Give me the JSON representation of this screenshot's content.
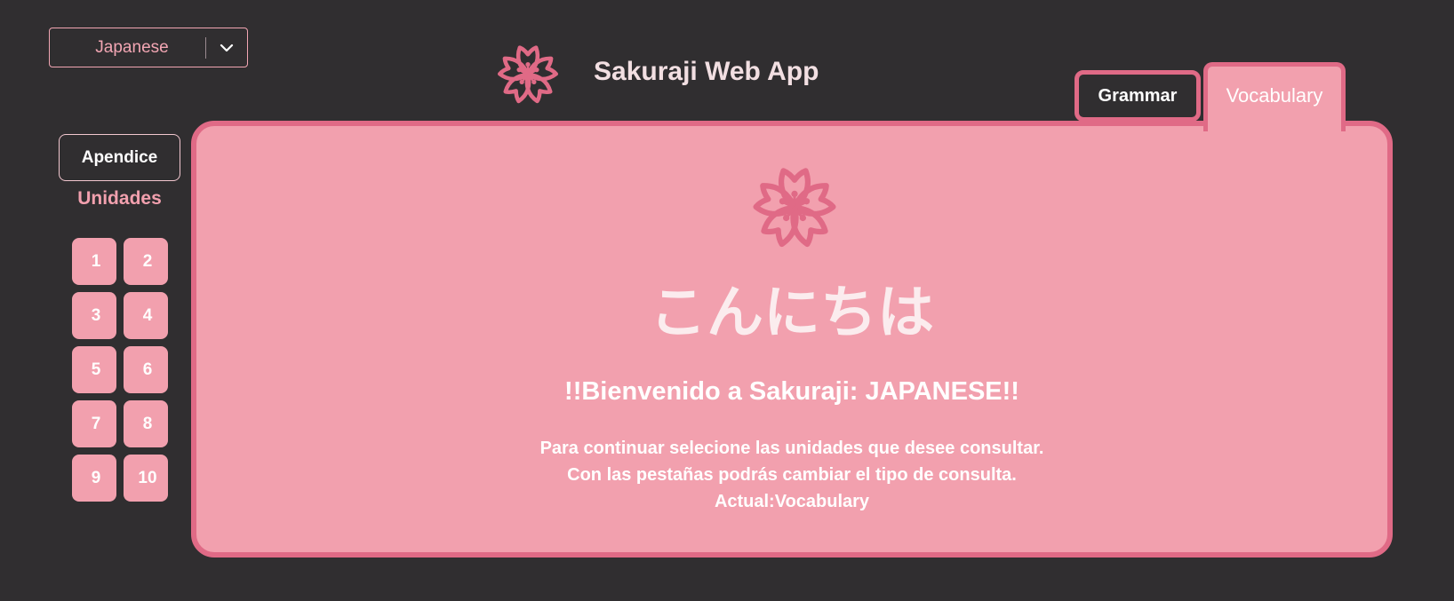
{
  "language_select": {
    "value": "Japanese"
  },
  "header": {
    "title": "Sakuraji Web App"
  },
  "tabs": [
    {
      "label": "Grammar",
      "active": false
    },
    {
      "label": "Vocabulary",
      "active": true
    }
  ],
  "sidebar": {
    "apendice_label": "Apendice",
    "unidades_title": "Unidades",
    "units": [
      "1",
      "2",
      "3",
      "4",
      "5",
      "6",
      "7",
      "8",
      "9",
      "10"
    ]
  },
  "main": {
    "greeting": "こんにちは",
    "welcome": "!!Bienvenido a Sakuraji: JAPANESE!!",
    "info_line_1": "Para continuar selecione las unidades que desee consultar.",
    "info_line_2": "Con las pestañas podrás cambiar el tipo de consulta.",
    "info_line_3": "Actual:Vocabulary"
  },
  "icons": {
    "logo": "sakura-flower-icon",
    "dropdown": "chevron-down-icon"
  },
  "colors": {
    "background": "#302e30",
    "accent_pink": "#f2a0ae",
    "border_pink": "#e06a86",
    "title_text": "#f2dfe2"
  }
}
